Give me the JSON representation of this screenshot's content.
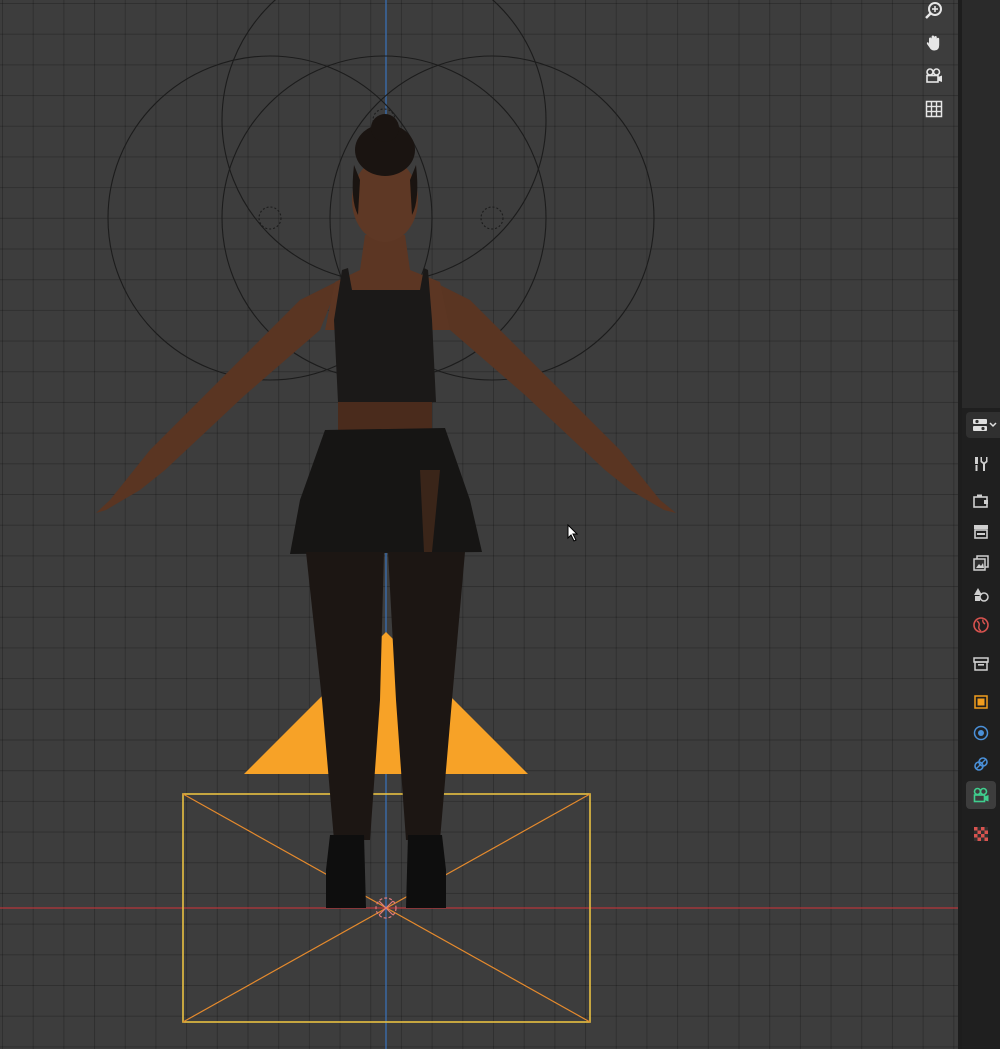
{
  "window": {
    "title": ""
  },
  "viewport": {
    "background_color": "#3d3d3d",
    "grid_color": "#2f2f2f",
    "x_axis_color": "#b5363b",
    "y_axis_color": "#3a6fb3",
    "selection_color": "#f29d1d",
    "camera_frame_color": "#e8b445"
  },
  "navigation_gizmo": {
    "buttons": [
      {
        "name": "zoom",
        "icon": "magnifier-icon"
      },
      {
        "name": "pan",
        "icon": "hand-icon"
      },
      {
        "name": "camera-view",
        "icon": "camera-icon"
      },
      {
        "name": "orthographic-toggle",
        "icon": "grid-icon"
      }
    ]
  },
  "properties_editor": {
    "editor_type_icon": "editor-type-icon",
    "tabs": [
      {
        "name": "tool",
        "icon": "tool-icon",
        "color": "#cfcfcf",
        "active": false
      },
      {
        "name": "render",
        "icon": "render-icon",
        "color": "#cfcfcf",
        "active": false
      },
      {
        "name": "output",
        "icon": "output-icon",
        "color": "#cfcfcf",
        "active": false
      },
      {
        "name": "view-layer",
        "icon": "view-layer-icon",
        "color": "#cfcfcf",
        "active": false
      },
      {
        "name": "scene",
        "icon": "scene-icon",
        "color": "#cfcfcf",
        "active": false
      },
      {
        "name": "world",
        "icon": "world-icon",
        "color": "#d9534f",
        "active": false
      },
      {
        "name": "collection",
        "icon": "collection-icon",
        "color": "#cfcfcf",
        "active": false
      },
      {
        "name": "object",
        "icon": "object-icon",
        "color": "#f29d1d",
        "active": false
      },
      {
        "name": "physics",
        "icon": "physics-icon",
        "color": "#4a90d9",
        "active": false
      },
      {
        "name": "object-constraints",
        "icon": "constraints-icon",
        "color": "#4a90d9",
        "active": false
      },
      {
        "name": "object-data-camera",
        "icon": "camera-data-icon",
        "color": "#3fcf8e",
        "active": true
      },
      {
        "name": "texture",
        "icon": "texture-icon",
        "color": "#d9534f",
        "active": false
      }
    ]
  }
}
